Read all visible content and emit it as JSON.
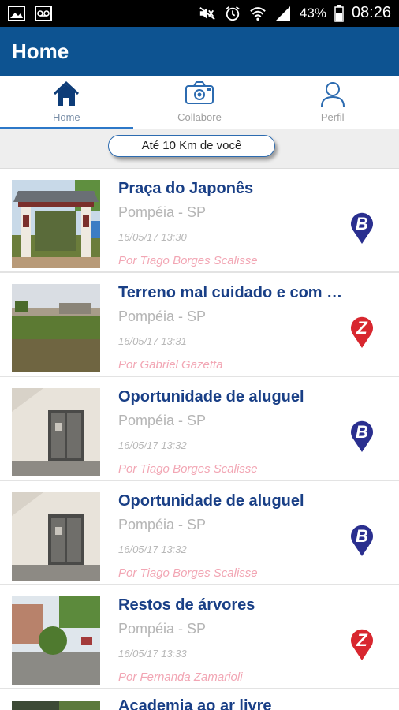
{
  "status_bar": {
    "battery": "43%",
    "time": "08:26"
  },
  "app_bar": {
    "title": "Home"
  },
  "tabs": [
    {
      "label": "Home",
      "icon": "home-icon",
      "active": true
    },
    {
      "label": "Collabore",
      "icon": "camera-icon",
      "active": false
    },
    {
      "label": "Perfil",
      "icon": "profile-icon",
      "active": false
    }
  ],
  "filter": {
    "label": "Até 10 Km de você"
  },
  "colors": {
    "primary": "#0d5391",
    "title": "#193f86",
    "author": "#f2a6b4",
    "marker_blue": "#2a2f8f",
    "marker_red": "#d8272f"
  },
  "items": [
    {
      "title": "Praça do Japonês",
      "location": "Pompéia - SP",
      "date": "16/05/17 13:30",
      "author": "Por Tiago Borges Scalisse",
      "marker": "b-marker-icon"
    },
    {
      "title": "Terreno mal cuidado e com mato alto",
      "location": "Pompéia - SP",
      "date": "16/05/17 13:31",
      "author": "Por Gabriel Gazetta",
      "marker": "z-marker-icon"
    },
    {
      "title": "Oportunidade de aluguel",
      "location": "Pompéia - SP",
      "date": "16/05/17 13:32",
      "author": "Por Tiago Borges Scalisse",
      "marker": "b-marker-icon"
    },
    {
      "title": "Oportunidade de aluguel",
      "location": "Pompéia - SP",
      "date": "16/05/17 13:32",
      "author": "Por Tiago Borges Scalisse",
      "marker": "b-marker-icon"
    },
    {
      "title": "Restos de árvores",
      "location": "Pompéia - SP",
      "date": "16/05/17 13:33",
      "author": "Por Fernanda Zamarioli",
      "marker": "z-marker-icon"
    },
    {
      "title": "Academia ao ar livre"
    }
  ]
}
